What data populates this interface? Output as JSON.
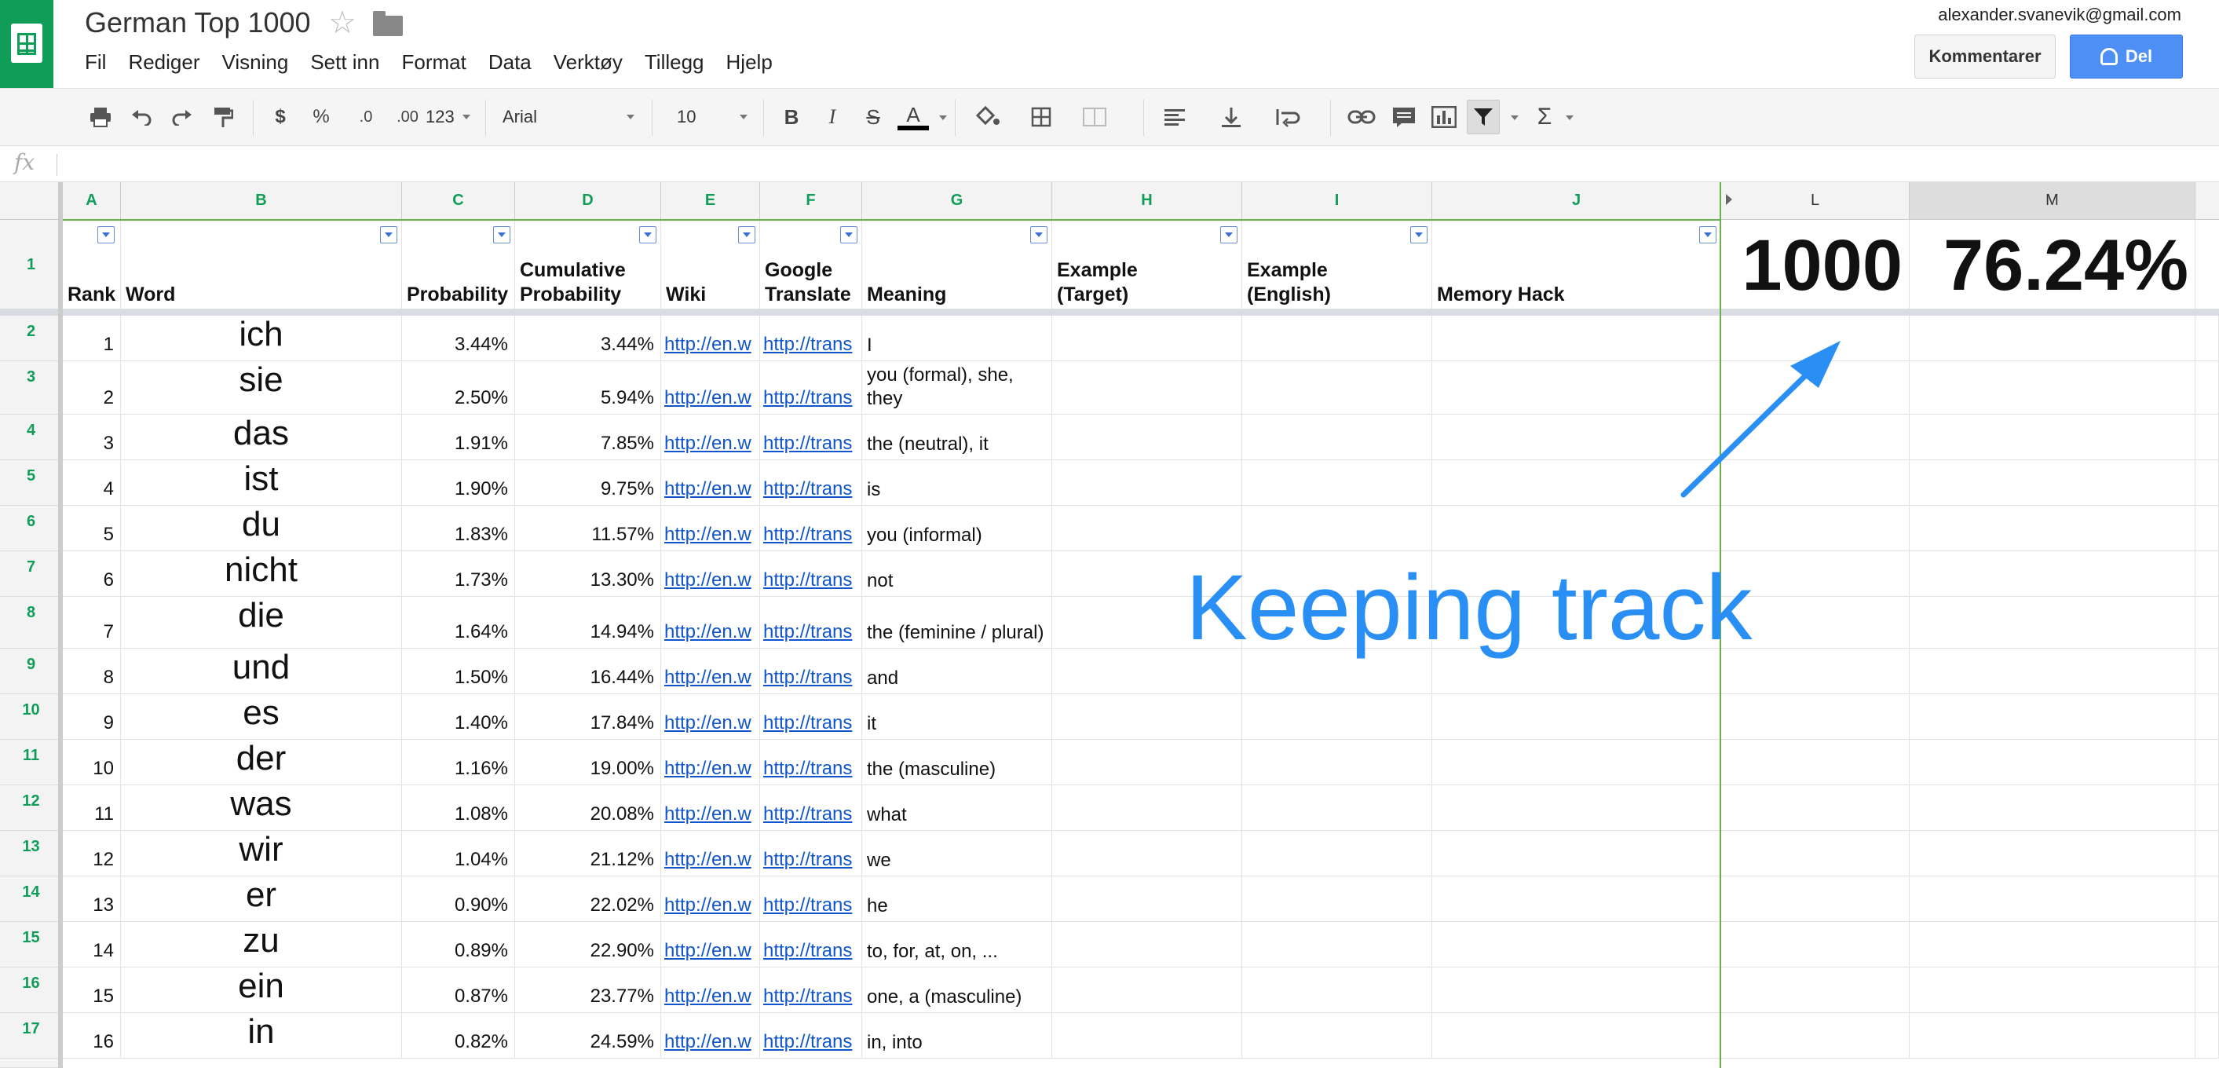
{
  "app": {
    "title": "German Top 1000",
    "user_email": "alexander.svanevik@gmail.com",
    "comment_button": "Kommentarer",
    "share_button": "Del",
    "menu": [
      "Fil",
      "Rediger",
      "Visning",
      "Sett inn",
      "Format",
      "Data",
      "Verktøy",
      "Tillegg",
      "Hjelp"
    ],
    "brand_color": "#0f9d58",
    "share_color": "#4d8ff5"
  },
  "toolbar": {
    "currency": "$",
    "percent": "%",
    "dec_less": ".0",
    "dec_more": ".00",
    "format_more": "123",
    "font": "Arial",
    "size": "10",
    "bold": "B",
    "italic": "I",
    "strike": "S",
    "text_color": "A",
    "sum": "Σ",
    "icons": [
      "print-icon",
      "undo-icon",
      "redo-icon",
      "paint-format-icon",
      "fill-color-icon",
      "borders-icon",
      "merge-icon",
      "align-left-icon",
      "valign-bottom-icon",
      "wrap-icon",
      "link-icon",
      "comment-icon",
      "chart-icon",
      "filter-icon"
    ]
  },
  "formula_bar": {
    "fx": "fx",
    "value": ""
  },
  "columns": [
    "A",
    "B",
    "C",
    "D",
    "E",
    "F",
    "G",
    "H",
    "I",
    "J",
    "L",
    "M"
  ],
  "header_row": {
    "row_number": "1",
    "rank": "Rank",
    "word": "Word",
    "probability": "Probability",
    "cumulative": "Cumulative Probability",
    "wiki": "Wiki",
    "google": "Google Translate",
    "meaning": "Meaning",
    "example_target": "Example (Target)",
    "example_english": "Example (English)",
    "memory_hack": "Memory Hack",
    "count": "1000",
    "coverage": "76.24%"
  },
  "rows": [
    {
      "n": "2",
      "rank": "1",
      "word": "ich",
      "prob": "3.44%",
      "cum": "3.44%",
      "wiki": "http://en.w",
      "gt": "http://trans",
      "meaning": "I"
    },
    {
      "n": "3",
      "rank": "2",
      "word": "sie",
      "prob": "2.50%",
      "cum": "5.94%",
      "wiki": "http://en.w",
      "gt": "http://trans",
      "meaning": "you (formal), she, they"
    },
    {
      "n": "4",
      "rank": "3",
      "word": "das",
      "prob": "1.91%",
      "cum": "7.85%",
      "wiki": "http://en.w",
      "gt": "http://trans",
      "meaning": "the (neutral), it"
    },
    {
      "n": "5",
      "rank": "4",
      "word": "ist",
      "prob": "1.90%",
      "cum": "9.75%",
      "wiki": "http://en.w",
      "gt": "http://trans",
      "meaning": "is"
    },
    {
      "n": "6",
      "rank": "5",
      "word": "du",
      "prob": "1.83%",
      "cum": "11.57%",
      "wiki": "http://en.w",
      "gt": "http://trans",
      "meaning": "you (informal)"
    },
    {
      "n": "7",
      "rank": "6",
      "word": "nicht",
      "prob": "1.73%",
      "cum": "13.30%",
      "wiki": "http://en.w",
      "gt": "http://trans",
      "meaning": "not"
    },
    {
      "n": "8",
      "rank": "7",
      "word": "die",
      "prob": "1.64%",
      "cum": "14.94%",
      "wiki": "http://en.w",
      "gt": "http://trans",
      "meaning": "the (feminine / plural)"
    },
    {
      "n": "9",
      "rank": "8",
      "word": "und",
      "prob": "1.50%",
      "cum": "16.44%",
      "wiki": "http://en.w",
      "gt": "http://trans",
      "meaning": "and"
    },
    {
      "n": "10",
      "rank": "9",
      "word": "es",
      "prob": "1.40%",
      "cum": "17.84%",
      "wiki": "http://en.w",
      "gt": "http://trans",
      "meaning": "it"
    },
    {
      "n": "11",
      "rank": "10",
      "word": "der",
      "prob": "1.16%",
      "cum": "19.00%",
      "wiki": "http://en.w",
      "gt": "http://trans",
      "meaning": "the (masculine)"
    },
    {
      "n": "12",
      "rank": "11",
      "word": "was",
      "prob": "1.08%",
      "cum": "20.08%",
      "wiki": "http://en.w",
      "gt": "http://trans",
      "meaning": "what"
    },
    {
      "n": "13",
      "rank": "12",
      "word": "wir",
      "prob": "1.04%",
      "cum": "21.12%",
      "wiki": "http://en.w",
      "gt": "http://trans",
      "meaning": "we"
    },
    {
      "n": "14",
      "rank": "13",
      "word": "er",
      "prob": "0.90%",
      "cum": "22.02%",
      "wiki": "http://en.w",
      "gt": "http://trans",
      "meaning": "he"
    },
    {
      "n": "15",
      "rank": "14",
      "word": "zu",
      "prob": "0.89%",
      "cum": "22.90%",
      "wiki": "http://en.w",
      "gt": "http://trans",
      "meaning": "to, for, at, on, ..."
    },
    {
      "n": "16",
      "rank": "15",
      "word": "ein",
      "prob": "0.87%",
      "cum": "23.77%",
      "wiki": "http://en.w",
      "gt": "http://trans",
      "meaning": "one, a (masculine)"
    },
    {
      "n": "17",
      "rank": "16",
      "word": "in",
      "prob": "0.82%",
      "cum": "24.59%",
      "wiki": "http://en.w",
      "gt": "http://trans",
      "meaning": "in, into"
    }
  ],
  "annotation": {
    "text": "Keeping track",
    "color": "#2a8ff5"
  }
}
